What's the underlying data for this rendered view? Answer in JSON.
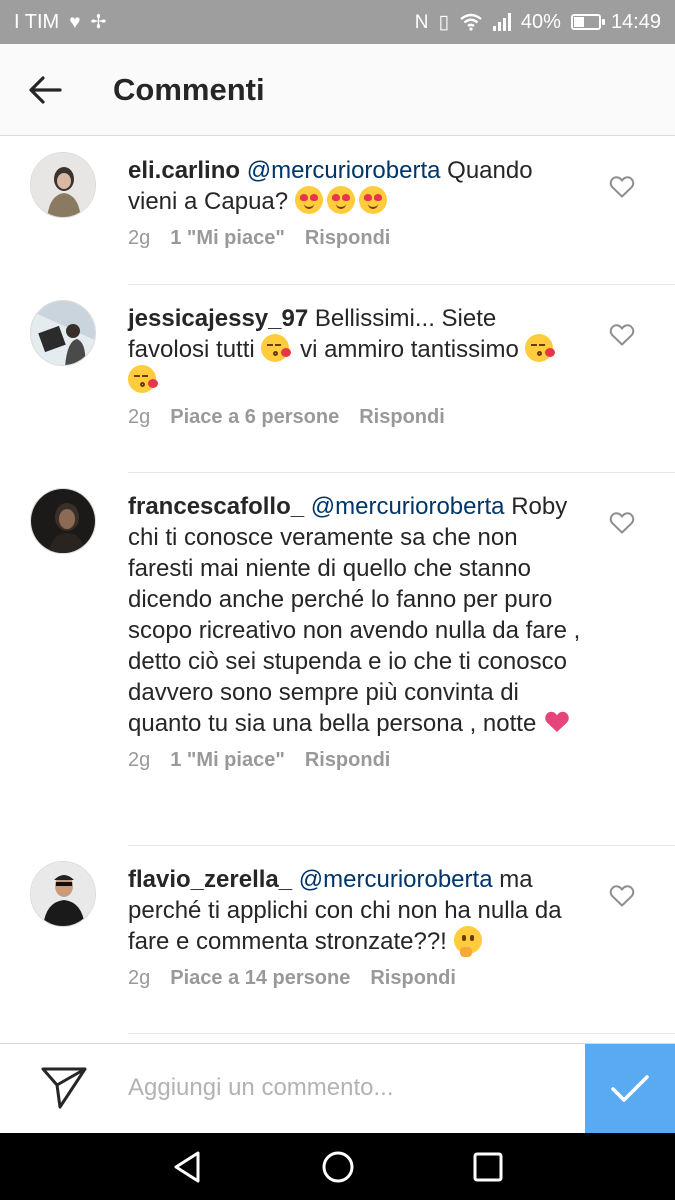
{
  "status_bar": {
    "carrier": "I TIM",
    "battery": "40%",
    "battery_level": 0.4,
    "time": "14:49"
  },
  "header": {
    "title": "Commenti",
    "back_icon": "arrow-left-icon"
  },
  "comments": [
    {
      "username": "eli.carlino",
      "mention": "@mercurioroberta",
      "text": "Quando vieni a Capua?",
      "emojis": [
        "heart-eyes",
        "heart-eyes",
        "heart-eyes"
      ],
      "age": "2g",
      "likes": "1 \"Mi piace\"",
      "reply": "Rispondi"
    },
    {
      "username": "jessicajessy_97",
      "mention": "",
      "text": "Bellissimi... Siete favolosi tutti",
      "text_after": "vi ammiro tantissimo",
      "emojis": [
        "kissing-heart",
        "kissing-heart",
        "kissing-heart"
      ],
      "age": "2g",
      "likes": "Piace a 6 persone",
      "reply": "Rispondi"
    },
    {
      "username": "francescafollo_",
      "mention": "@mercurioroberta",
      "text": "Roby chi ti conosce veramente sa che non faresti mai niente di quello che stanno dicendo anche perché lo fanno per puro scopo ricreativo non avendo nulla da fare , detto ciò sei stupenda e io che ti conosco davvero sono sempre più convinta di quanto tu sia una bella persona , notte",
      "emojis": [
        "pink-heart"
      ],
      "age": "2g",
      "likes": "1 \"Mi piace\"",
      "reply": "Rispondi"
    },
    {
      "username": "flavio_zerella_",
      "mention": "@mercurioroberta",
      "text": "ma perché ti applichi con chi non ha nulla da fare e commenta stronzate??!",
      "emojis": [
        "thinking-face"
      ],
      "age": "2g",
      "likes": "Piace a 14 persone",
      "reply": "Rispondi"
    }
  ],
  "composer": {
    "placeholder": "Aggiungi un commento...",
    "send_icon": "paper-plane-icon",
    "post_icon": "checkmark-icon"
  },
  "colors": {
    "status_bar": "#9e9e9e",
    "mention": "#003569",
    "meta": "#999999",
    "post_button": "#5aaaf2"
  }
}
